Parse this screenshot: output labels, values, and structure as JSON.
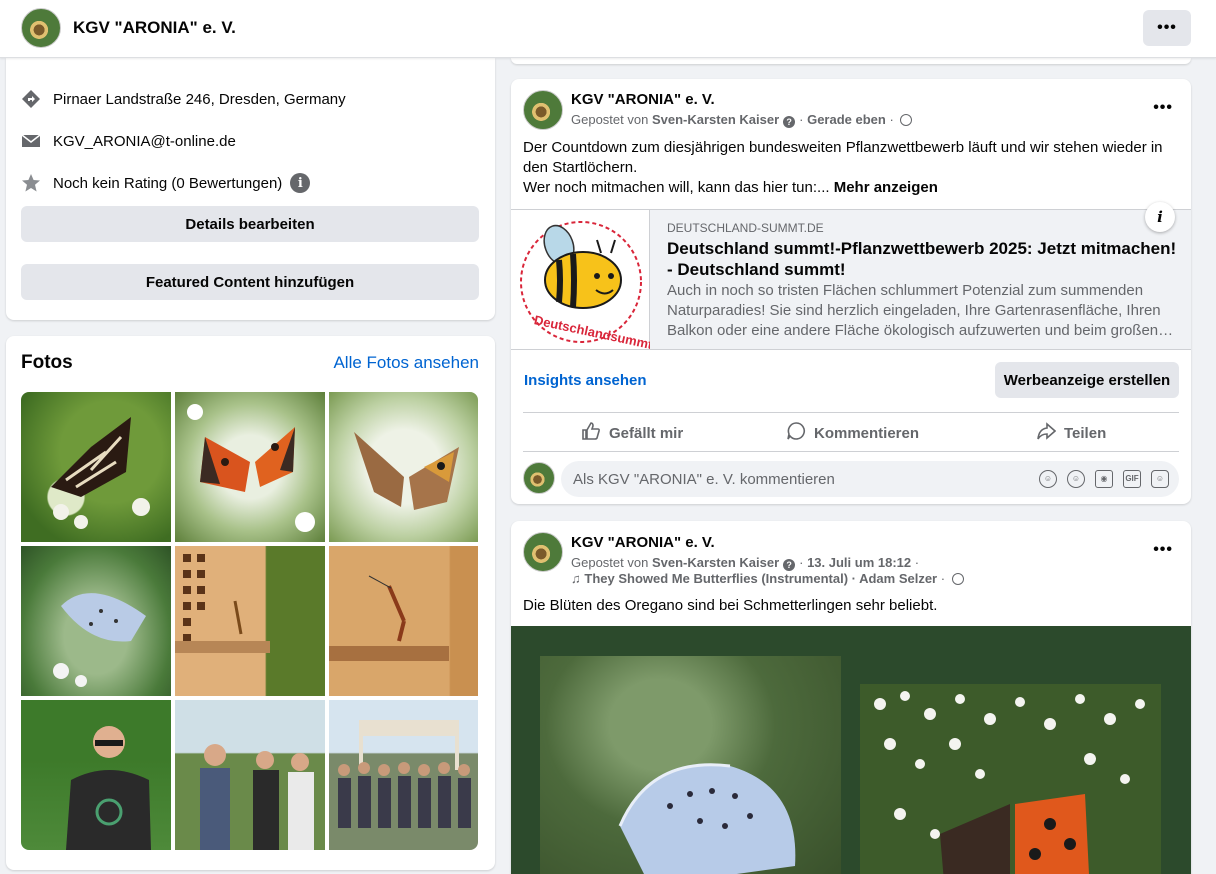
{
  "page": {
    "name": "KGV \"ARONIA\" e. V.",
    "more_label": "•••"
  },
  "intro": {
    "address": "Pirnaer Landstraße 246, Dresden, Germany",
    "email": "KGV_ARONIA@t-online.de",
    "rating": "Noch kein Rating (0 Bewertungen)",
    "rating_info": "i",
    "edit_details": "Details bearbeiten",
    "add_featured": "Featured Content hinzufügen"
  },
  "photos": {
    "title": "Fotos",
    "see_all": "Alle Fotos ansehen"
  },
  "post1": {
    "author": "KGV \"ARONIA\" e. V.",
    "posted_by_prefix": "Gepostet von",
    "posted_by": "Sven-Karsten Kaiser",
    "time": "Gerade eben",
    "text_line1": "Der Countdown zum diesjährigen bundesweiten Pflanzwettbewerb läuft und wir stehen wieder in den Startlöchern.",
    "text_line2": "Wer noch mitmachen will, kann das hier tun:...",
    "see_more": "Mehr anzeigen",
    "link_domain": "DEUTSCHLAND-SUMMT.DE",
    "link_title": "Deutschland summt!-Pflanzwettbewerb 2025: Jetzt mitmachen! - Deutschland summt!",
    "link_desc": "Auch in noch so tristen Flächen schlummert Potenzial zum summenden Naturparadies! Sie sind herzlich eingeladen, Ihre Gartenrasenfläche, Ihren Balkon oder eine andere Fläche ökologisch aufzuwerten und beim großen…",
    "link_thumb_text": "Deutschlandsummt!",
    "insights": "Insights ansehen",
    "create_ad": "Werbeanzeige erstellen",
    "like": "Gefällt mir",
    "comment": "Kommentieren",
    "share": "Teilen",
    "comment_placeholder": "Als KGV \"ARONIA\" e. V. kommentieren"
  },
  "post2": {
    "author": "KGV \"ARONIA\" e. V.",
    "posted_by_prefix": "Gepostet von",
    "posted_by": "Sven-Karsten Kaiser",
    "time": "13. Juli um 18:12",
    "music": "They Showed Me Butterflies (Instrumental) · Adam Selzer",
    "text": "Die Blüten des Oregano sind bei Schmetterlingen sehr beliebt."
  },
  "colors": {
    "link_blue": "#0064d1",
    "secondary_text": "#65676b",
    "button_gray": "#e4e6eb",
    "media_bg": "#2c4a2c"
  }
}
